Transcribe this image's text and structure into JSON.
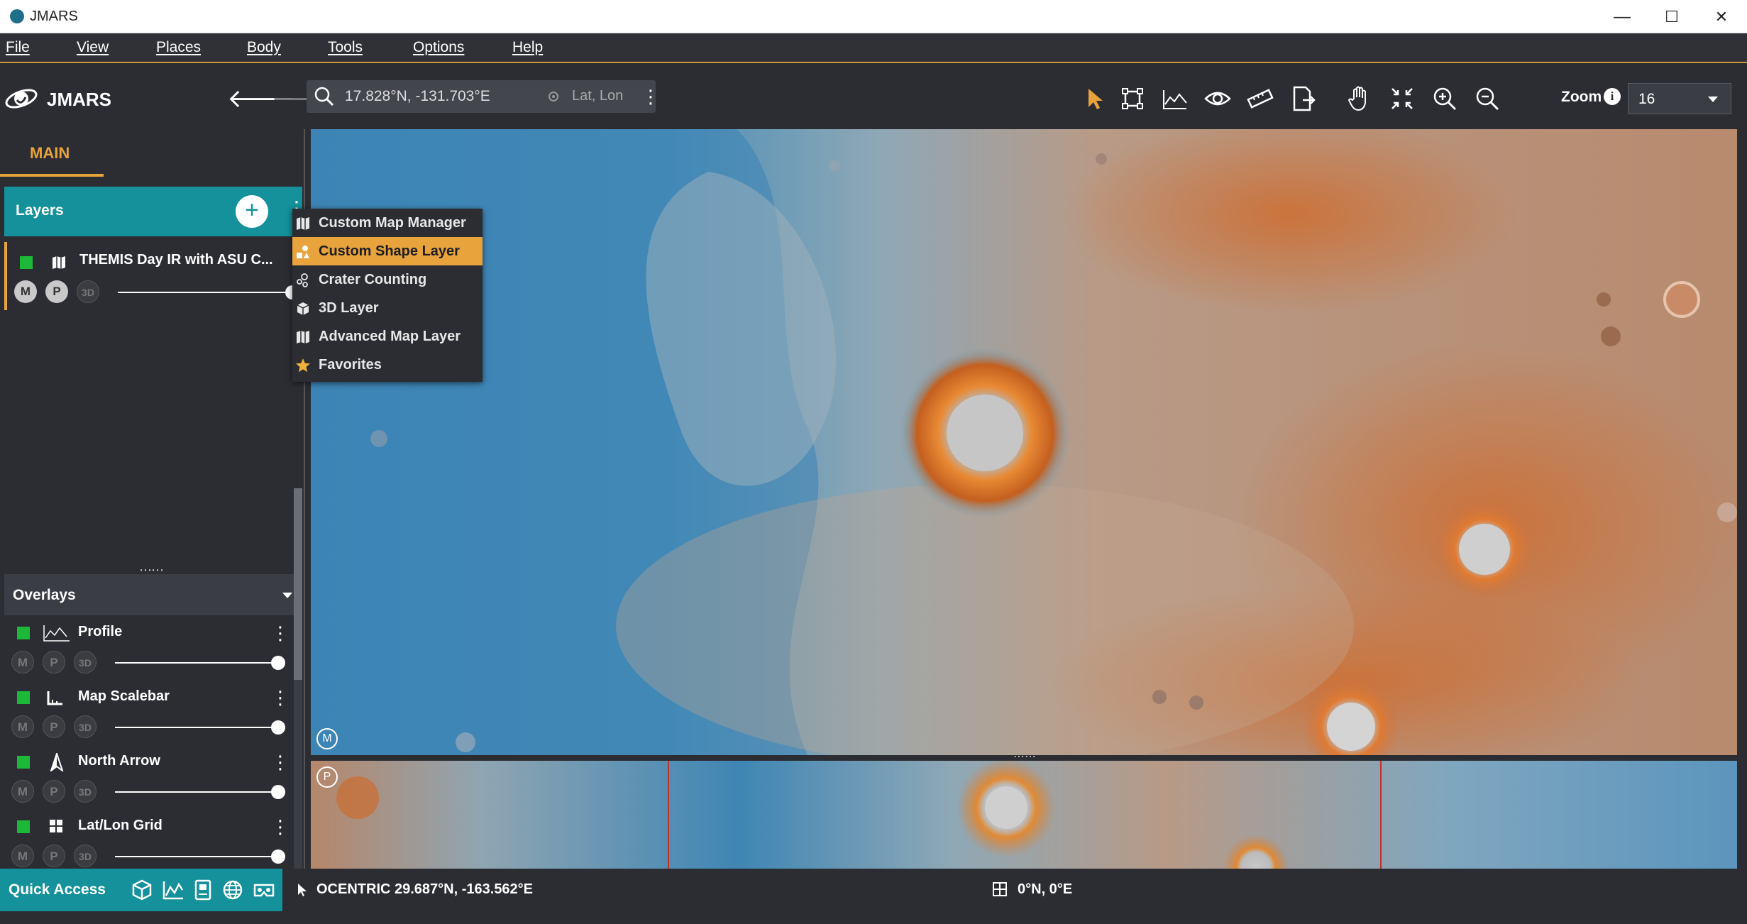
{
  "window": {
    "title": "JMARS",
    "minimize": "—",
    "maximize": "☐",
    "close": "✕"
  },
  "menu": [
    "File",
    "View",
    "Places",
    "Body",
    "Tools",
    "Options",
    "Help"
  ],
  "app": {
    "logo_text": "JMARS"
  },
  "search": {
    "value": "17.828°N, -131.703°E",
    "coord_type": "Lat, Lon"
  },
  "toolbar": {
    "tools": [
      "select-arrow-icon",
      "resize-select-icon",
      "profile-line-icon",
      "eye-icon",
      "ruler-icon",
      "export-icon",
      "pan-hand-icon",
      "fit-extent-icon",
      "zoom-in-icon",
      "zoom-out-icon"
    ],
    "zoom_label": "Zoom",
    "zoom_info": "i",
    "zoom_value": "16"
  },
  "tabs": {
    "main": "MAIN"
  },
  "layers": {
    "header": "Layers",
    "add": "+",
    "items": [
      {
        "name": "THEMIS Day IR with ASU C...",
        "chips": [
          "M",
          "P",
          "3D"
        ],
        "opacity": 1.0
      }
    ]
  },
  "overlays": {
    "header": "Overlays",
    "items": [
      {
        "name": "Profile",
        "chips": [
          "M",
          "P",
          "3D"
        ],
        "opacity": 1.0
      },
      {
        "name": "Map Scalebar",
        "chips": [
          "M",
          "P",
          "3D"
        ],
        "opacity": 1.0
      },
      {
        "name": "North Arrow",
        "chips": [
          "M",
          "P",
          "3D"
        ],
        "opacity": 1.0
      },
      {
        "name": "Lat/Lon Grid",
        "chips": [
          "M",
          "P",
          "3D"
        ],
        "opacity": 1.0
      }
    ]
  },
  "add_layer_menu": {
    "items": [
      {
        "label": "Custom Map Manager",
        "icon": "map-icon"
      },
      {
        "label": "Custom Shape Layer",
        "icon": "shapes-icon",
        "active": true
      },
      {
        "label": "Crater Counting",
        "icon": "crater-icon"
      },
      {
        "label": "3D Layer",
        "icon": "cube-icon"
      },
      {
        "label": "Advanced Map Layer",
        "icon": "map-icon"
      },
      {
        "label": "Favorites",
        "icon": "star-icon"
      }
    ]
  },
  "map": {
    "main_badge": "M",
    "panner_badge": "P"
  },
  "quick_access": {
    "label": "Quick Access",
    "icons": [
      "cube-icon",
      "chart-icon",
      "book-icon",
      "globe-icon",
      "vr-icon"
    ]
  },
  "status": {
    "projection": "OCENTRIC",
    "cursor_coord": "29.687°N, -163.562°E",
    "center": "0°N, 0°E"
  },
  "colors": {
    "accent": "#e8a33d",
    "teal": "#14919b",
    "panel": "#2b2d33",
    "visible": "#1db83a"
  }
}
